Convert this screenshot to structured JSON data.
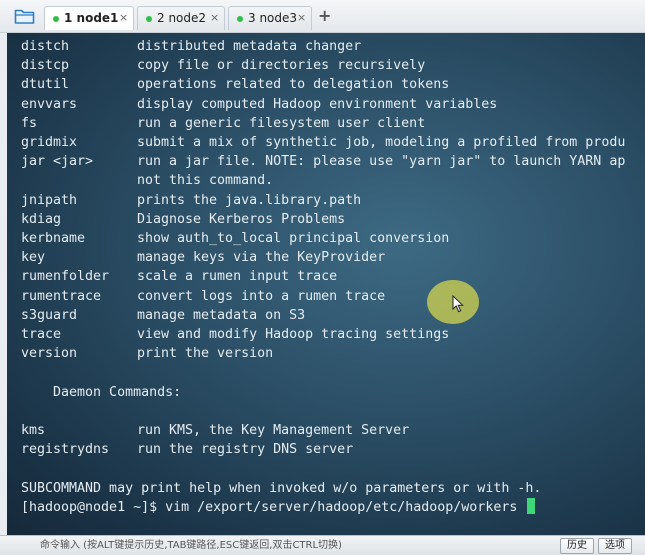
{
  "tabs": [
    {
      "label": "1 node1",
      "close": "×",
      "active": true
    },
    {
      "label": "2 node2",
      "close": "×",
      "active": false
    },
    {
      "label": "3 node3",
      "close": "×",
      "active": false
    }
  ],
  "add_tab": "+",
  "terminal": {
    "commands": [
      {
        "name": "distch",
        "desc": "distributed metadata changer"
      },
      {
        "name": "distcp",
        "desc": "copy file or directories recursively"
      },
      {
        "name": "dtutil",
        "desc": "operations related to delegation tokens"
      },
      {
        "name": "envvars",
        "desc": "display computed Hadoop environment variables"
      },
      {
        "name": "fs",
        "desc": "run a generic filesystem user client"
      },
      {
        "name": "gridmix",
        "desc": "submit a mix of synthetic job, modeling a profiled from produ"
      },
      {
        "name": "jar <jar>",
        "desc": "run a jar file. NOTE: please use \"yarn jar\" to launch YARN ap"
      },
      {
        "name": "",
        "desc": "not this command."
      },
      {
        "name": "jnipath",
        "desc": "prints the java.library.path"
      },
      {
        "name": "kdiag",
        "desc": "Diagnose Kerberos Problems"
      },
      {
        "name": "kerbname",
        "desc": "show auth_to_local principal conversion"
      },
      {
        "name": "key",
        "desc": "manage keys via the KeyProvider"
      },
      {
        "name": "rumenfolder",
        "desc": "scale a rumen input trace"
      },
      {
        "name": "rumentrace",
        "desc": "convert logs into a rumen trace"
      },
      {
        "name": "s3guard",
        "desc": "manage metadata on S3"
      },
      {
        "name": "trace",
        "desc": "view and modify Hadoop tracing settings"
      },
      {
        "name": "version",
        "desc": "print the version"
      }
    ],
    "daemon_heading": "    Daemon Commands:",
    "daemon_commands": [
      {
        "name": "kms",
        "desc": "run KMS, the Key Management Server"
      },
      {
        "name": "registrydns",
        "desc": "run the registry DNS server"
      }
    ],
    "subcommand_note": "SUBCOMMAND may print help when invoked w/o parameters or with -h.",
    "prompt": "[hadoop@node1 ~]$ vim /export/server/hadoop/etc/hadoop/workers "
  },
  "input_bar": {
    "hint": "命令输入 (按ALT键提示历史,TAB键路径,ESC键返回,双击CTRL切换)",
    "history_button": "历史",
    "options_button": "选项"
  },
  "colors": {
    "tab_active_dot": "#2fbf4a",
    "terminal_text": "#e4ecf1",
    "cursor": "#3fd678",
    "pointer_highlight": "#ccd050"
  }
}
